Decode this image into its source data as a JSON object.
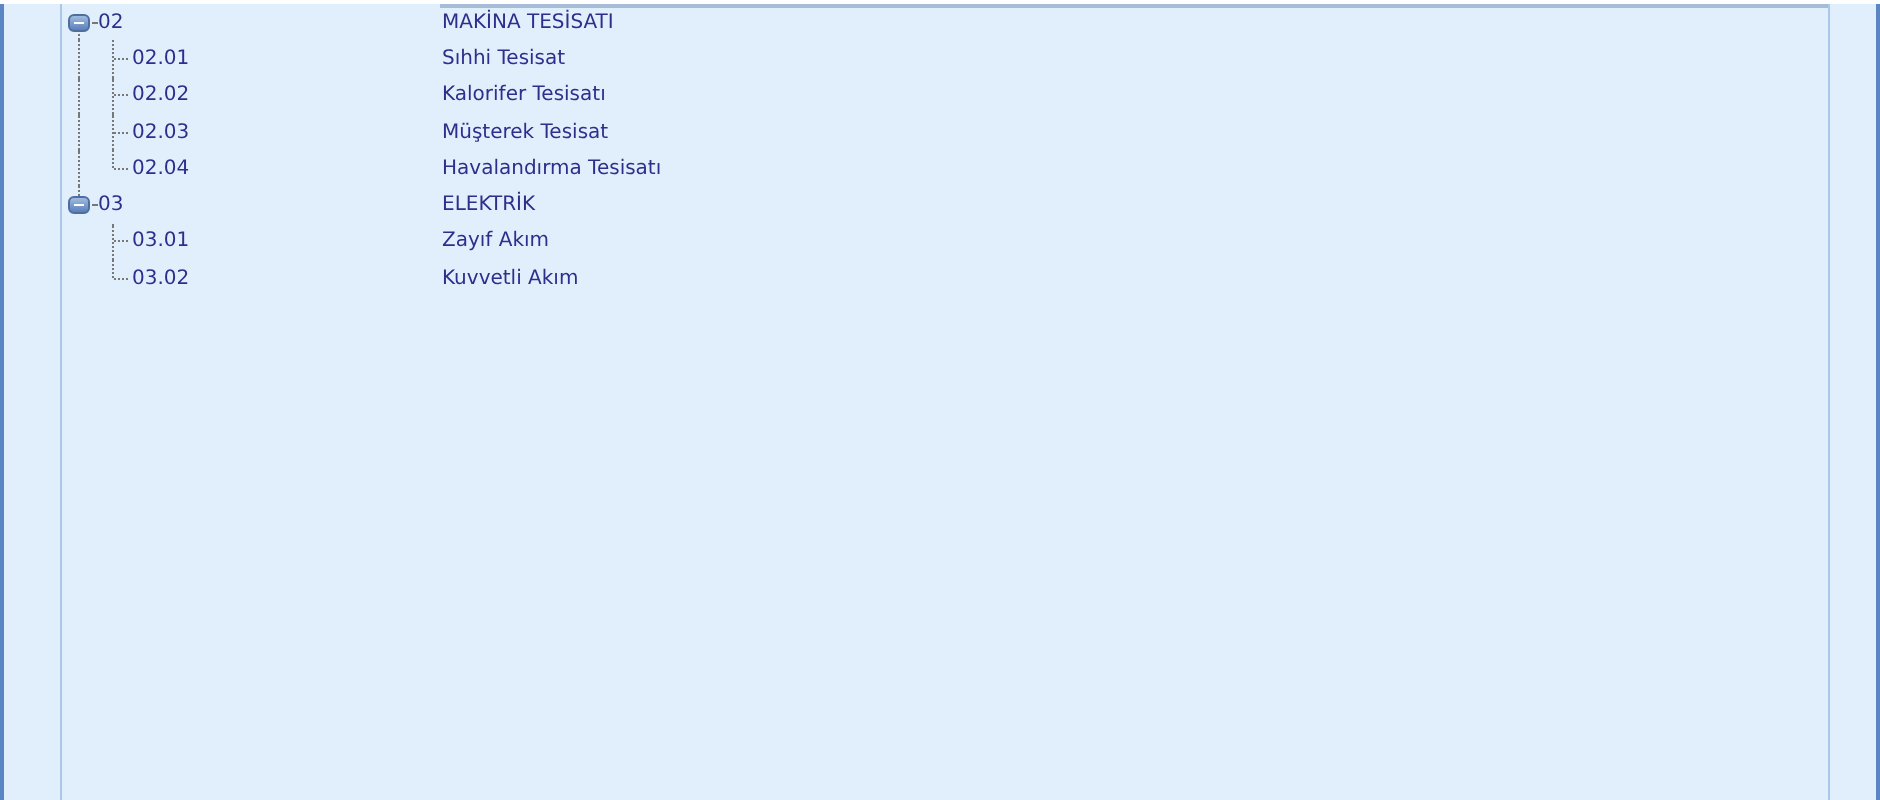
{
  "tree": {
    "rows": [
      {
        "code": "02",
        "name": "MAKİNA TESİSATI",
        "expanded": true,
        "children": [
          {
            "code": "02.01",
            "name": "Sıhhi Tesisat"
          },
          {
            "code": "02.02",
            "name": "Kalorifer Tesisatı"
          },
          {
            "code": "02.03",
            "name": "Müşterek Tesisat"
          },
          {
            "code": "02.04",
            "name": "Havalandırma Tesisatı"
          }
        ]
      },
      {
        "code": "03",
        "name": "ELEKTRİK",
        "expanded": true,
        "children": [
          {
            "code": "03.01",
            "name": "Zayıf Akım"
          },
          {
            "code": "03.02",
            "name": "Kuvvetli Akım"
          }
        ]
      }
    ]
  }
}
